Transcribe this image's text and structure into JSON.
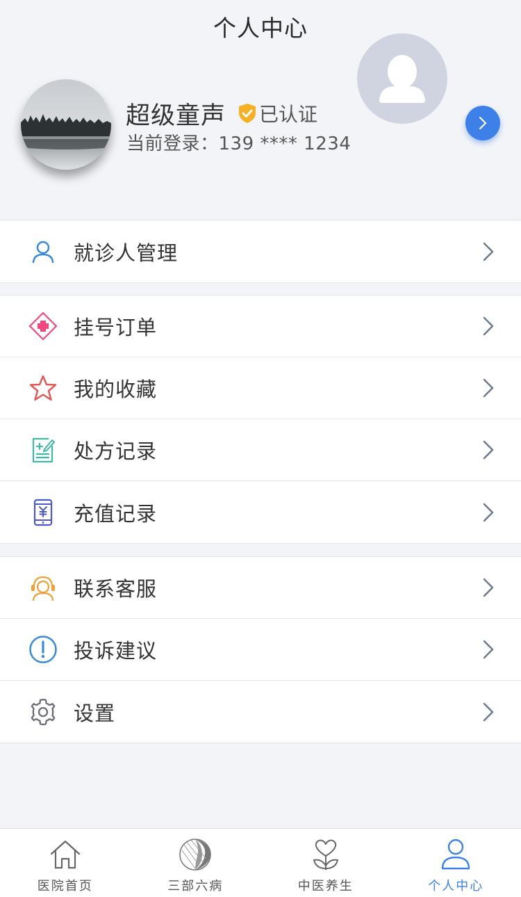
{
  "header": {
    "title": "个人中心"
  },
  "profile": {
    "name": "超级童声",
    "verified_label": "已认证",
    "login_info": "当前登录：139 **** 1234"
  },
  "menu_groups": [
    {
      "items": [
        {
          "label": "就诊人管理",
          "icon": "user-icon"
        }
      ]
    },
    {
      "items": [
        {
          "label": "挂号订单",
          "icon": "medical-cross-icon"
        },
        {
          "label": "我的收藏",
          "icon": "star-icon"
        },
        {
          "label": "处方记录",
          "icon": "prescription-icon"
        },
        {
          "label": "充值记录",
          "icon": "phone-yuan-icon"
        }
      ]
    },
    {
      "items": [
        {
          "label": "联系客服",
          "icon": "headset-icon"
        },
        {
          "label": "投诉建议",
          "icon": "exclamation-icon"
        },
        {
          "label": "设置",
          "icon": "gear-icon"
        }
      ]
    }
  ],
  "tabbar": {
    "tabs": [
      {
        "label": "医院首页",
        "icon": "home-icon",
        "active": false
      },
      {
        "label": "三部六病",
        "icon": "leaf-circle-icon",
        "active": false
      },
      {
        "label": "中医养生",
        "icon": "heart-plant-icon",
        "active": false
      },
      {
        "label": "个人中心",
        "icon": "person-icon",
        "active": true
      }
    ]
  },
  "colors": {
    "accent": "#3d80e8",
    "background": "#f2f4f8",
    "verified_badge": "#f5b025",
    "star": "#e05a5a",
    "medical_cross": "#f0477c",
    "prescription": "#3fb8a6",
    "recharge": "#4a58c9",
    "headset": "#f0a038",
    "exclamation": "#3a8ad8",
    "gear": "#6b6b7b"
  }
}
